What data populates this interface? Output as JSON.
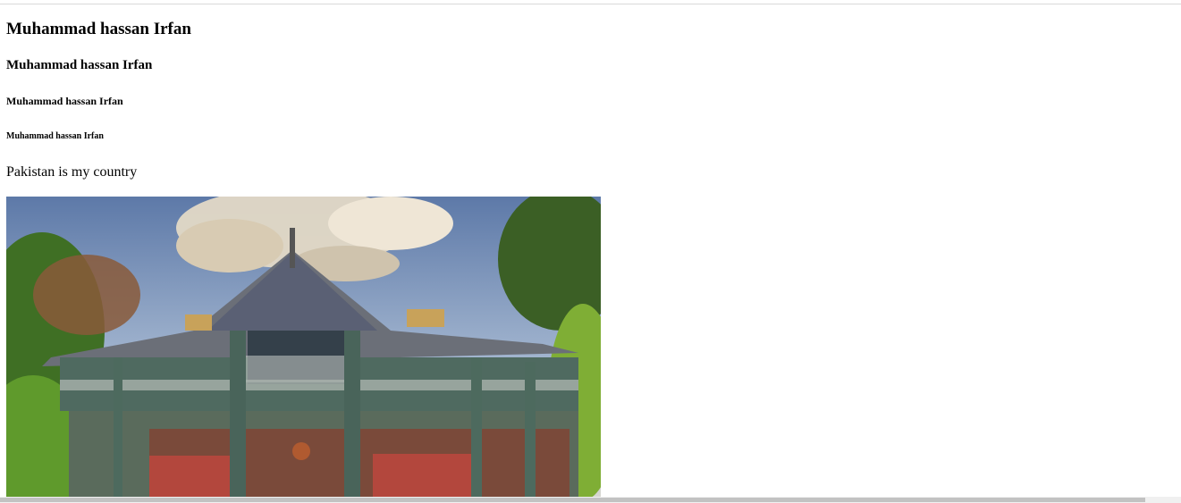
{
  "headings": {
    "h1": "Muhammad hassan Irfan",
    "h2": "Muhammad hassan Irfan",
    "h3": "Muhammad hassan Irfan",
    "h4": "Muhammad hassan Irfan"
  },
  "paragraph": "Pakistan is my country",
  "image": {
    "description": "historic wooden colonial house with green balconies and trees"
  },
  "colors": {
    "sky": "#7a90b5",
    "building_green": "#5c7a64",
    "roof": "#6b6f78",
    "foliage": "#3f7a2a",
    "brick": "#8a4a3a",
    "window_red": "#b3473d"
  }
}
